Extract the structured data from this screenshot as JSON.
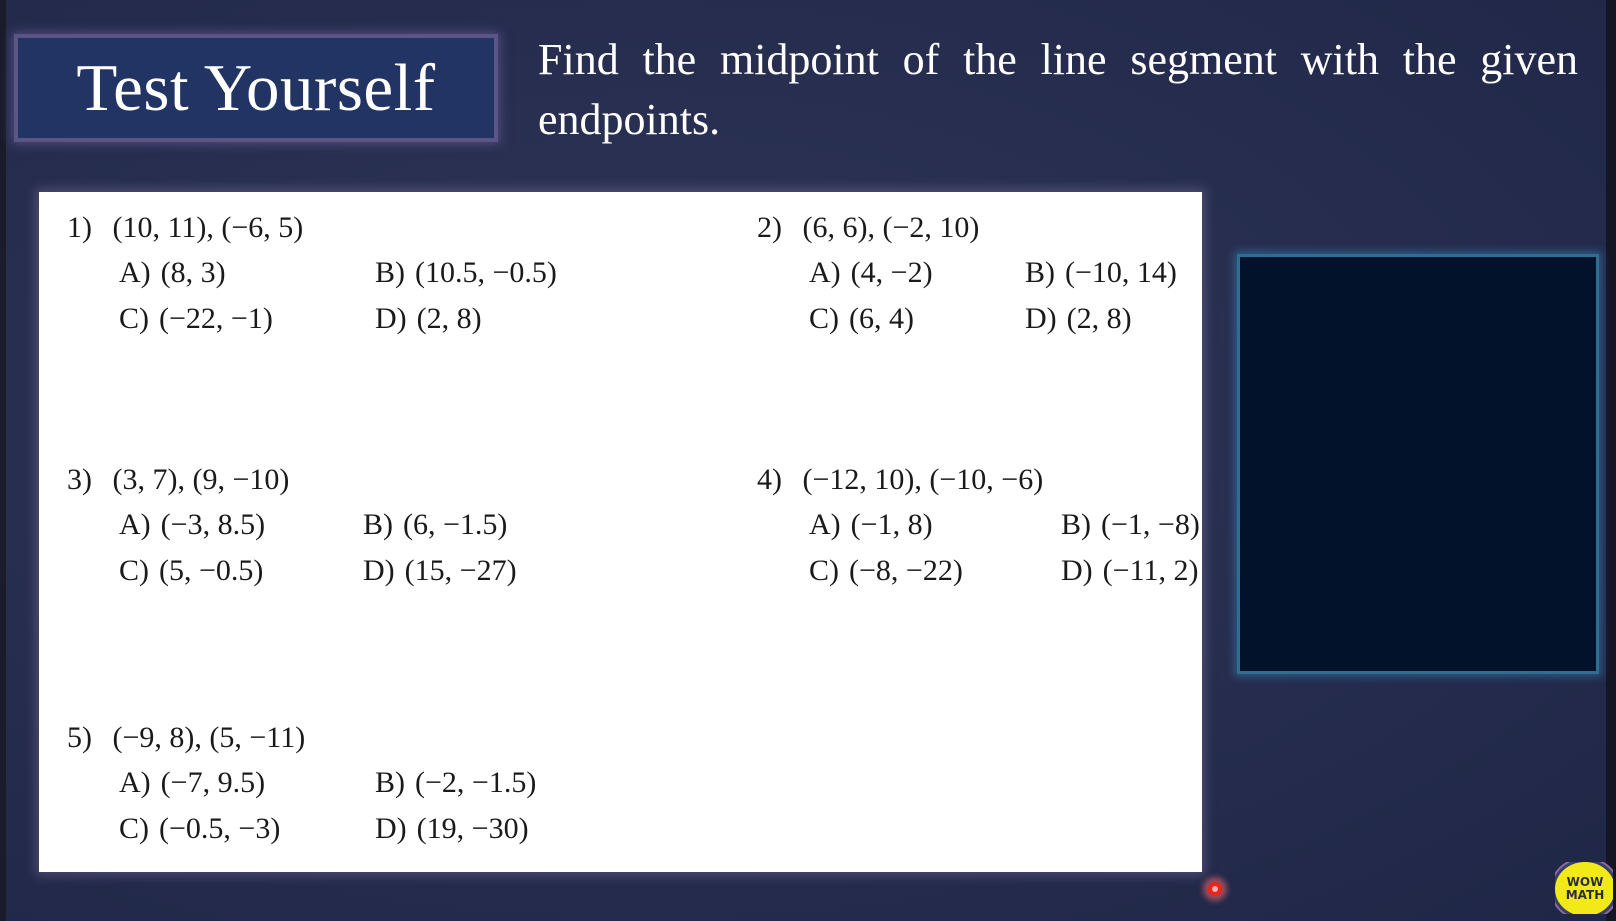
{
  "slide": {
    "title": "Test Yourself",
    "instruction": "Find the midpoint of the line segment with the given endpoints."
  },
  "problems": [
    {
      "number": "1)",
      "endpoints": "(10, 11), (−6, 5)",
      "choices": [
        {
          "letter": "A)",
          "value": "(8, 3)"
        },
        {
          "letter": "B)",
          "value": "(10.5, −0.5)"
        },
        {
          "letter": "C)",
          "value": "(−22, −1)"
        },
        {
          "letter": "D)",
          "value": "(2, 8)"
        }
      ]
    },
    {
      "number": "2)",
      "endpoints": "(6, 6), (−2, 10)",
      "choices": [
        {
          "letter": "A)",
          "value": "(4, −2)"
        },
        {
          "letter": "B)",
          "value": "(−10, 14)"
        },
        {
          "letter": "C)",
          "value": "(6, 4)"
        },
        {
          "letter": "D)",
          "value": "(2, 8)"
        }
      ]
    },
    {
      "number": "3)",
      "endpoints": "(3, 7), (9, −10)",
      "choices": [
        {
          "letter": "A)",
          "value": "(−3, 8.5)"
        },
        {
          "letter": "B)",
          "value": "(6, −1.5)"
        },
        {
          "letter": "C)",
          "value": "(5, −0.5)"
        },
        {
          "letter": "D)",
          "value": "(15, −27)"
        }
      ]
    },
    {
      "number": "4)",
      "endpoints": "(−12, 10), (−10, −6)",
      "choices": [
        {
          "letter": "A)",
          "value": "(−1, 8)"
        },
        {
          "letter": "B)",
          "value": "(−1, −8)"
        },
        {
          "letter": "C)",
          "value": "(−8, −22)"
        },
        {
          "letter": "D)",
          "value": "(−11, 2)"
        }
      ]
    },
    {
      "number": "5)",
      "endpoints": "(−9, 8), (5, −11)",
      "choices": [
        {
          "letter": "A)",
          "value": "(−7, 9.5)"
        },
        {
          "letter": "B)",
          "value": "(−2, −1.5)"
        },
        {
          "letter": "C)",
          "value": "(−0.5, −3)"
        },
        {
          "letter": "D)",
          "value": "(19, −30)"
        }
      ]
    }
  ],
  "logo": {
    "line1": "WOW",
    "line2": "MATH"
  },
  "colors": {
    "background": "#262d4f",
    "title_box": "#223463",
    "video_panel": "#02122a",
    "video_border": "#2f6e93",
    "cursor": "#e8241c",
    "logo": "#f2ea18"
  }
}
